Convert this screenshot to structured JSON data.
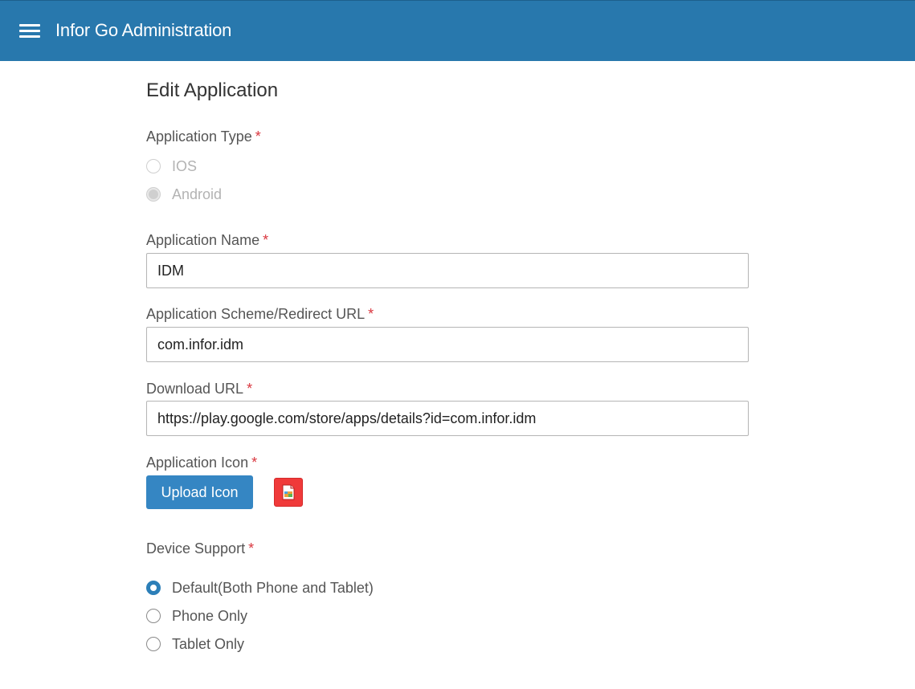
{
  "header": {
    "title": "Infor Go Administration",
    "menu_icon": "hamburger-menu-icon",
    "bg_color": "#2878ad"
  },
  "page": {
    "title": "Edit Application"
  },
  "form": {
    "required_marker": "*",
    "application_type": {
      "label": "Application Type",
      "options": [
        {
          "label": "IOS",
          "selected": false,
          "disabled": true
        },
        {
          "label": "Android",
          "selected": true,
          "disabled": true
        }
      ]
    },
    "application_name": {
      "label": "Application Name",
      "value": "IDM"
    },
    "scheme_url": {
      "label": "Application Scheme/Redirect URL",
      "value": "com.infor.idm"
    },
    "download_url": {
      "label": "Download URL",
      "value": "https://play.google.com/store/apps/details?id=com.infor.idm"
    },
    "application_icon": {
      "label": "Application Icon",
      "upload_label": "Upload Icon",
      "preview_icon": "app-icon-preview",
      "button_color": "#3586c3",
      "preview_color": "#f03a3a"
    },
    "device_support": {
      "label": "Device Support",
      "options": [
        {
          "label": "Default(Both Phone and Tablet)",
          "selected": true
        },
        {
          "label": "Phone Only",
          "selected": false
        },
        {
          "label": "Tablet Only",
          "selected": false
        }
      ],
      "accent_color": "#2c7fb8"
    }
  }
}
